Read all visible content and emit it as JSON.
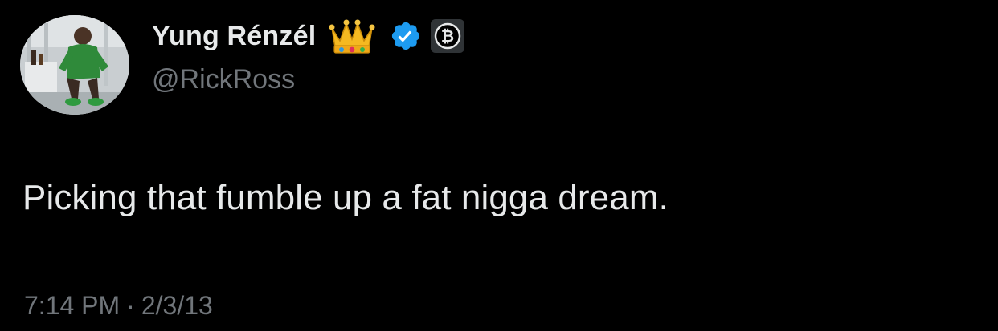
{
  "tweet": {
    "display_name": "Yung Rénzél",
    "handle": "@RickRoss",
    "text": "Picking that fumble up a fat nigga dream.",
    "time": "7:14 PM",
    "separator": "·",
    "date": "2/3/13"
  },
  "icons": {
    "crown": "crown-emoji-icon",
    "verified": "verified-badge-icon",
    "affiliate": "bitcoin-icon"
  },
  "colors": {
    "background": "#000000",
    "text_primary": "#e7e9ea",
    "text_secondary": "#71767b",
    "verified_blue": "#1d9bf0"
  }
}
